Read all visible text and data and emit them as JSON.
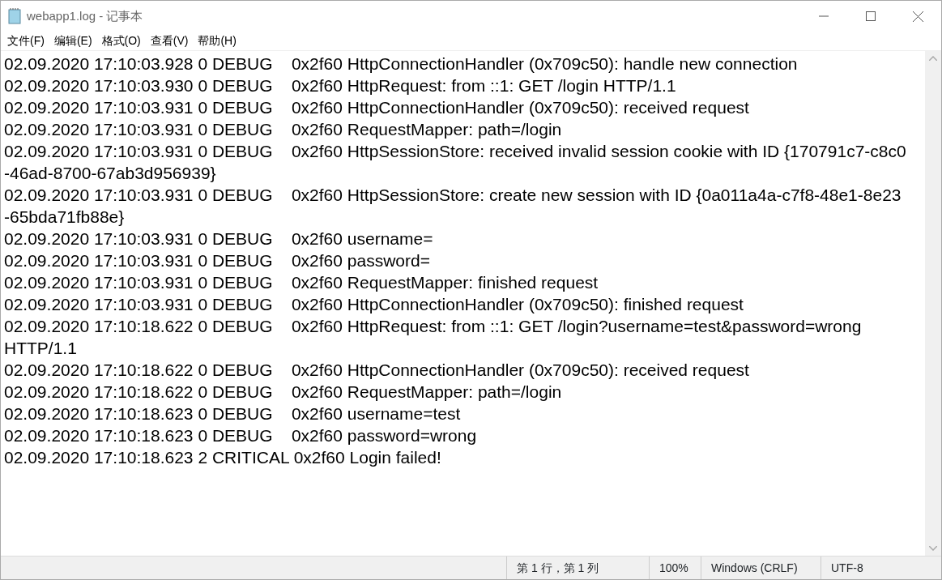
{
  "window": {
    "title": "webapp1.log - 记事本"
  },
  "menu": [
    "文件(F)",
    "编辑(E)",
    "格式(O)",
    "查看(V)",
    "帮助(H)"
  ],
  "lines": [
    "02.09.2020 17:10:03.928 0 DEBUG    0x2f60 HttpConnectionHandler (0x709c50): handle new connection",
    "02.09.2020 17:10:03.930 0 DEBUG    0x2f60 HttpRequest: from ::1: GET /login HTTP/1.1",
    "02.09.2020 17:10:03.931 0 DEBUG    0x2f60 HttpConnectionHandler (0x709c50): received request",
    "02.09.2020 17:10:03.931 0 DEBUG    0x2f60 RequestMapper: path=/login",
    "02.09.2020 17:10:03.931 0 DEBUG    0x2f60 HttpSessionStore: received invalid session cookie with ID {170791c7-c8c0",
    "-46ad-8700-67ab3d956939}",
    "02.09.2020 17:10:03.931 0 DEBUG    0x2f60 HttpSessionStore: create new session with ID {0a011a4a-c7f8-48e1-8e23",
    "-65bda71fb88e}",
    "02.09.2020 17:10:03.931 0 DEBUG    0x2f60 username=",
    "02.09.2020 17:10:03.931 0 DEBUG    0x2f60 password=",
    "02.09.2020 17:10:03.931 0 DEBUG    0x2f60 RequestMapper: finished request",
    "02.09.2020 17:10:03.931 0 DEBUG    0x2f60 HttpConnectionHandler (0x709c50): finished request",
    "02.09.2020 17:10:18.622 0 DEBUG    0x2f60 HttpRequest: from ::1: GET /login?username=test&password=wrong",
    "HTTP/1.1",
    "02.09.2020 17:10:18.622 0 DEBUG    0x2f60 HttpConnectionHandler (0x709c50): received request",
    "02.09.2020 17:10:18.622 0 DEBUG    0x2f60 RequestMapper: path=/login",
    "02.09.2020 17:10:18.623 0 DEBUG    0x2f60 username=test",
    "02.09.2020 17:10:18.623 0 DEBUG    0x2f60 password=wrong",
    "02.09.2020 17:10:18.623 2 CRITICAL 0x2f60 Login failed!"
  ],
  "status_bar": {
    "position": "第 1 行，第 1 列",
    "zoom": "100%",
    "line_ending": "Windows (CRLF)",
    "encoding": "UTF-8"
  }
}
